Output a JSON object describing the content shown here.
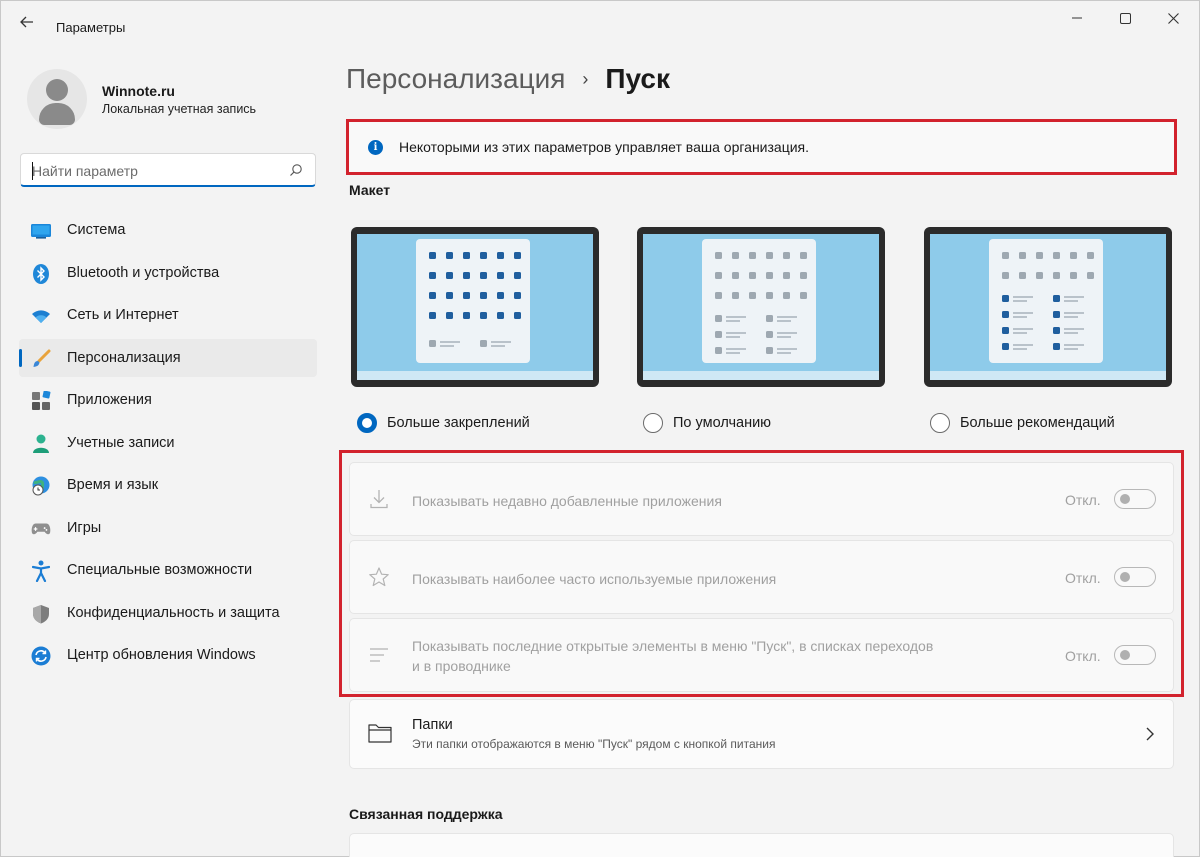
{
  "window": {
    "title": "Параметры"
  },
  "user": {
    "name": "Winnote.ru",
    "account_type": "Локальная учетная запись"
  },
  "search": {
    "placeholder": "Найти параметр"
  },
  "sidebar": {
    "items": [
      {
        "label": "Система",
        "icon": "system-icon"
      },
      {
        "label": "Bluetooth и устройства",
        "icon": "bluetooth-icon"
      },
      {
        "label": "Сеть и Интернет",
        "icon": "wifi-icon"
      },
      {
        "label": "Персонализация",
        "icon": "brush-icon",
        "active": true
      },
      {
        "label": "Приложения",
        "icon": "apps-icon"
      },
      {
        "label": "Учетные записи",
        "icon": "account-icon"
      },
      {
        "label": "Время и язык",
        "icon": "globe-clock-icon"
      },
      {
        "label": "Игры",
        "icon": "gamepad-icon"
      },
      {
        "label": "Специальные возможности",
        "icon": "accessibility-icon"
      },
      {
        "label": "Конфиденциальность и защита",
        "icon": "shield-icon"
      },
      {
        "label": "Центр обновления Windows",
        "icon": "update-icon"
      }
    ]
  },
  "breadcrumb": {
    "parent": "Персонализация",
    "separator": "›",
    "current": "Пуск"
  },
  "notice": {
    "text": "Некоторыми из этих параметров управляет ваша организация."
  },
  "layout": {
    "title": "Макет",
    "options": [
      {
        "label": "Больше закреплений",
        "selected": true
      },
      {
        "label": "По умолчанию",
        "selected": false
      },
      {
        "label": "Больше рекомендаций",
        "selected": false
      }
    ]
  },
  "settings": [
    {
      "label": "Показывать недавно добавленные приложения",
      "state": "Откл.",
      "icon": "download-icon",
      "on": false
    },
    {
      "label": "Показывать наиболее часто используемые приложения",
      "state": "Откл.",
      "icon": "star-icon",
      "on": false
    },
    {
      "label_line1": "Показывать последние открытые элементы в меню \"Пуск\", в списках переходов",
      "label_line2": "и в проводнике",
      "state": "Откл.",
      "icon": "list-icon",
      "on": false
    }
  ],
  "folders": {
    "title": "Папки",
    "description": "Эти папки отображаются в меню \"Пуск\" рядом с кнопкой питания"
  },
  "related_support": {
    "title": "Связанная поддержка"
  },
  "colors": {
    "accent": "#0067c0",
    "highlight": "#d2222d"
  }
}
